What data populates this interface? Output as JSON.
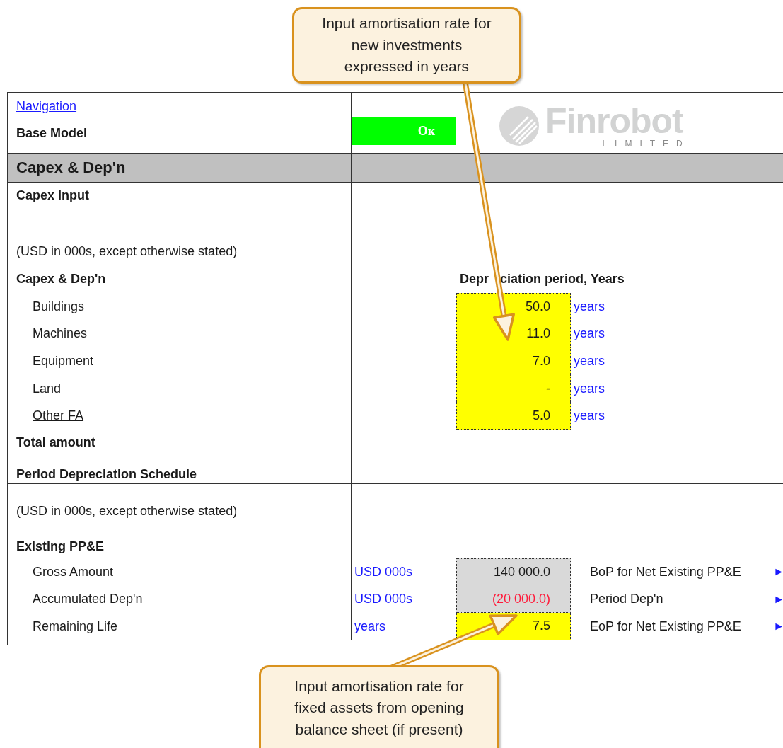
{
  "navigation_link": "Navigation",
  "model": {
    "label": "Base Model",
    "status": "Ок"
  },
  "logo": {
    "name": "Finrobot",
    "subtitle": "LIMITED"
  },
  "section_title": "Capex & Dep'n",
  "capex_input": {
    "title": "Capex Input",
    "note": "(USD in 000s, except otherwise stated)"
  },
  "depreciation": {
    "title": "Capex & Dep'n",
    "column_header": [
      "Depr",
      "ciation period, Years"
    ],
    "rows": [
      {
        "label": "Buildings",
        "value": "50.0",
        "unit": "years",
        "underlined": false
      },
      {
        "label": "Machines",
        "value": "11.0",
        "unit": "years",
        "underlined": false
      },
      {
        "label": "Equipment",
        "value": "7.0",
        "unit": "years",
        "underlined": false
      },
      {
        "label": "Land",
        "value": "-",
        "unit": "years",
        "underlined": false
      },
      {
        "label": "Other FA",
        "value": "5.0",
        "unit": "years",
        "underlined": true
      }
    ]
  },
  "total_label": "Total amount",
  "schedule": {
    "title": "Period Depreciation Schedule",
    "note": "(USD in 000s, except otherwise stated)"
  },
  "existing": {
    "title": "Existing PP&E",
    "rows": [
      {
        "label": "Gross Amount",
        "unit": "USD 000s",
        "value": "140 000.0",
        "kind": "calculated",
        "negative": false,
        "link": "BoP for Net Existing PP&E",
        "underlined": false,
        "arrow": "►"
      },
      {
        "label": "Accumulated Dep'n",
        "unit": "USD 000s",
        "value": "(20 000.0)",
        "kind": "calculated",
        "negative": true,
        "link": "Period Dep'n",
        "underlined": true,
        "arrow": "►"
      },
      {
        "label": "Remaining Life",
        "unit": "years",
        "value": "7.5",
        "kind": "input",
        "negative": false,
        "link": "EoP for Net Existing PP&E",
        "underlined": false,
        "arrow": "►"
      }
    ]
  },
  "callouts": [
    {
      "lines": [
        "Input amortisation rate for",
        "new investments",
        "expressed in years"
      ]
    },
    {
      "lines": [
        "Input amortisation rate for",
        "fixed assets from opening",
        "balance sheet (if present)"
      ]
    }
  ]
}
